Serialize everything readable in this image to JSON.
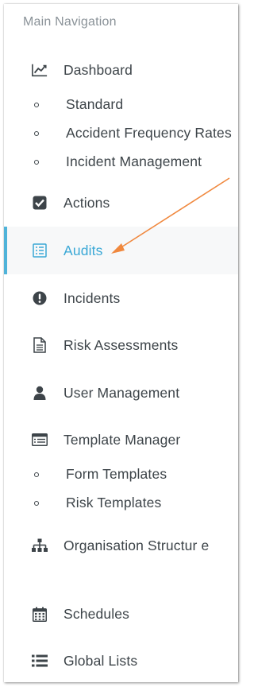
{
  "nav": {
    "section_header": "Main Navigation",
    "dashboard": {
      "label": "Dashboard",
      "icon": "line-chart-icon",
      "children": [
        "Standard",
        "Accident Frequency Rates",
        "Incident Management"
      ]
    },
    "actions": {
      "label": "Actions",
      "icon": "checkbox-icon"
    },
    "audits": {
      "label": "Audits",
      "icon": "checklist-icon",
      "active": true
    },
    "incidents": {
      "label": "Incidents",
      "icon": "exclamation-icon"
    },
    "risk_assessments": {
      "label": "Risk Assessments",
      "icon": "document-icon"
    },
    "user_management": {
      "label": "User Management",
      "icon": "user-icon"
    },
    "template_manager": {
      "label": "Template Manager",
      "icon": "template-icon",
      "children": [
        "Form Templates",
        "Risk Templates"
      ]
    },
    "organisation_structure": {
      "label": "Organisation Structur\ne",
      "icon": "sitemap-icon"
    },
    "schedules": {
      "label": "Schedules",
      "icon": "calendar-icon"
    },
    "global_lists": {
      "label": "Global Lists",
      "icon": "list-icon"
    }
  },
  "colors": {
    "accent": "#3aa8d6",
    "active_bar": "#4fb3d9",
    "annotation_arrow": "#f0883e",
    "text": "#3d4449",
    "header_text": "#8a9298"
  }
}
